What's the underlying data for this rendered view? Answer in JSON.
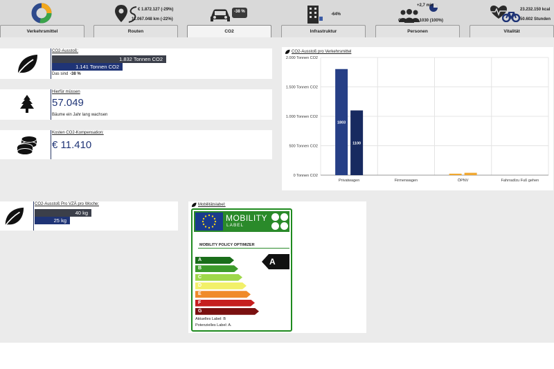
{
  "header": {
    "kpis": {
      "routes_a": "€ 1.872.127 (-29%)",
      "routes_b": "11.067.048 km (-22%)",
      "co2": "-38 %",
      "infra": "-64%",
      "persons_a": "+2,7 min",
      "persons_b": "Getroffen: 1030 (100%)",
      "vital_a": "23.232.150 kcal",
      "vital_b": "50.602 Stunden"
    },
    "tabs": [
      "Verkehrsmittel",
      "Routen",
      "CO2",
      "Infrastruktur",
      "Personen",
      "Vitalität"
    ],
    "active_tab": "CO2"
  },
  "co2_card": {
    "title": "CO2-Ausstoß:",
    "bar1": "1.832 Tonnen CO2",
    "bar2": "1.141 Tonnen CO2",
    "note_prefix": "Das sind",
    "note_value": "-38 %"
  },
  "trees_card": {
    "title": "Hierfür müssen",
    "value": "57.049",
    "sub": "Bäume ein Jahr lang wachsen"
  },
  "cost_card": {
    "title": "Kosten CO2-Kompensation:",
    "value": "€ 11.410"
  },
  "week_card": {
    "title": "CO2-Ausstoß Pro VZÄ pro Woche:",
    "bar1": "40 kg",
    "bar2": "25 kg"
  },
  "chart_data": {
    "type": "bar",
    "title": "CO2-Ausstoß pro Verkehrsmittel",
    "categories": [
      "Privatwagen",
      "Firmenwagen",
      "ÖPNV",
      "Fahrrad/zu Fuß gehen"
    ],
    "series": [
      {
        "values": [
          1803,
          0,
          25,
          0
        ],
        "color": "#263f86"
      },
      {
        "values": [
          1100,
          0,
          40,
          0
        ],
        "color": "#172a60"
      }
    ],
    "data_labels": [
      "1803",
      "1100"
    ],
    "yticks": [
      "2.000 Tonnen CO2",
      "1.500 Tonnen CO2",
      "1.000 Tonnen CO2",
      "500 Tonnen CO2",
      "0 Tonnen CO2"
    ],
    "ytick_values": [
      2000,
      1500,
      1000,
      500,
      0
    ],
    "ylim": [
      0,
      2000
    ],
    "grid": true,
    "lowvalue_color": "#f0a830"
  },
  "mobility_label": {
    "title": "Mobilitätslabel:",
    "brand": "MOBILITY",
    "brand_sub": "LABEL",
    "subtitle": "MOBILITY POLICY OPTIMIZER",
    "classes": [
      {
        "letter": "A",
        "color": "#1a6e1a"
      },
      {
        "letter": "B",
        "color": "#3d9b2a"
      },
      {
        "letter": "C",
        "color": "#9fd84a"
      },
      {
        "letter": "D",
        "color": "#f2f06a"
      },
      {
        "letter": "E",
        "color": "#f08a2a"
      },
      {
        "letter": "F",
        "color": "#c61f1f"
      },
      {
        "letter": "G",
        "color": "#7a1010"
      }
    ],
    "current": "A",
    "current_label": "Aktuelles Label: B",
    "potential_label": "Potenzielles Label: A."
  }
}
